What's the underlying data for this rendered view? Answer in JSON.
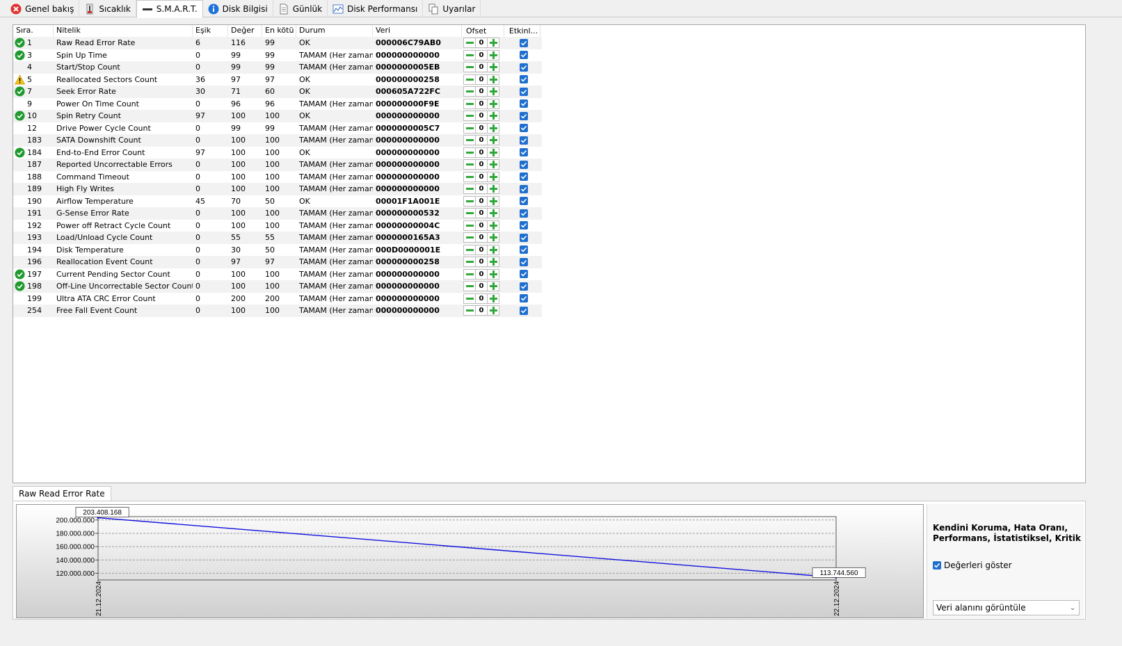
{
  "tabs": [
    {
      "label": "Genel bakış",
      "icon": "error-icon"
    },
    {
      "label": "Sıcaklık",
      "icon": "thermometer-icon"
    },
    {
      "label": "S.M.A.R.T.",
      "icon": "dash-icon"
    },
    {
      "label": "Disk Bilgisi",
      "icon": "info-icon"
    },
    {
      "label": "Günlük",
      "icon": "document-icon"
    },
    {
      "label": "Disk Performansı",
      "icon": "chart-icon"
    },
    {
      "label": "Uyarılar",
      "icon": "copy-icon"
    }
  ],
  "table": {
    "headers": {
      "id": "Sıra.",
      "name": "Nitelik",
      "threshold": "Eşik",
      "value": "Değer",
      "worst": "En kötü",
      "status": "Durum",
      "data": "Veri",
      "offset": "Ofset",
      "enabled": "Etkinl..."
    },
    "rows": [
      {
        "id": "1",
        "name": "Raw Read Error Rate",
        "threshold": "6",
        "value": "116",
        "worst": "99",
        "status": "OK",
        "data": "000006C79AB0",
        "offset": "0",
        "icon": "ok"
      },
      {
        "id": "3",
        "name": "Spin Up Time",
        "threshold": "0",
        "value": "99",
        "worst": "99",
        "status": "TAMAM (Her zaman ...",
        "data": "000000000000",
        "offset": "0",
        "icon": "ok"
      },
      {
        "id": "4",
        "name": "Start/Stop Count",
        "threshold": "0",
        "value": "99",
        "worst": "99",
        "status": "TAMAM (Her zaman ...",
        "data": "0000000005EB",
        "offset": "0",
        "icon": ""
      },
      {
        "id": "5",
        "name": "Reallocated Sectors Count",
        "threshold": "36",
        "value": "97",
        "worst": "97",
        "status": "OK",
        "data": "000000000258",
        "offset": "0",
        "icon": "warn"
      },
      {
        "id": "7",
        "name": "Seek Error Rate",
        "threshold": "30",
        "value": "71",
        "worst": "60",
        "status": "OK",
        "data": "000605A722FC",
        "offset": "0",
        "icon": "ok"
      },
      {
        "id": "9",
        "name": "Power On Time Count",
        "threshold": "0",
        "value": "96",
        "worst": "96",
        "status": "TAMAM (Her zaman ...",
        "data": "000000000F9E",
        "offset": "0",
        "icon": ""
      },
      {
        "id": "10",
        "name": "Spin Retry Count",
        "threshold": "97",
        "value": "100",
        "worst": "100",
        "status": "OK",
        "data": "000000000000",
        "offset": "0",
        "icon": "ok"
      },
      {
        "id": "12",
        "name": "Drive Power Cycle Count",
        "threshold": "0",
        "value": "99",
        "worst": "99",
        "status": "TAMAM (Her zaman ...",
        "data": "0000000005C7",
        "offset": "0",
        "icon": ""
      },
      {
        "id": "183",
        "name": "SATA Downshift Count",
        "threshold": "0",
        "value": "100",
        "worst": "100",
        "status": "TAMAM (Her zaman ...",
        "data": "000000000000",
        "offset": "0",
        "icon": ""
      },
      {
        "id": "184",
        "name": "End-to-End Error Count",
        "threshold": "97",
        "value": "100",
        "worst": "100",
        "status": "OK",
        "data": "000000000000",
        "offset": "0",
        "icon": "ok"
      },
      {
        "id": "187",
        "name": "Reported Uncorrectable Errors",
        "threshold": "0",
        "value": "100",
        "worst": "100",
        "status": "TAMAM (Her zaman ...",
        "data": "000000000000",
        "offset": "0",
        "icon": ""
      },
      {
        "id": "188",
        "name": "Command Timeout",
        "threshold": "0",
        "value": "100",
        "worst": "100",
        "status": "TAMAM (Her zaman ...",
        "data": "000000000000",
        "offset": "0",
        "icon": ""
      },
      {
        "id": "189",
        "name": "High Fly Writes",
        "threshold": "0",
        "value": "100",
        "worst": "100",
        "status": "TAMAM (Her zaman ...",
        "data": "000000000000",
        "offset": "0",
        "icon": ""
      },
      {
        "id": "190",
        "name": "Airflow Temperature",
        "threshold": "45",
        "value": "70",
        "worst": "50",
        "status": "OK",
        "data": "00001F1A001E",
        "offset": "0",
        "icon": ""
      },
      {
        "id": "191",
        "name": "G-Sense Error Rate",
        "threshold": "0",
        "value": "100",
        "worst": "100",
        "status": "TAMAM (Her zaman ...",
        "data": "000000000532",
        "offset": "0",
        "icon": ""
      },
      {
        "id": "192",
        "name": "Power off Retract Cycle Count",
        "threshold": "0",
        "value": "100",
        "worst": "100",
        "status": "TAMAM (Her zaman ...",
        "data": "00000000004C",
        "offset": "0",
        "icon": ""
      },
      {
        "id": "193",
        "name": "Load/Unload Cycle Count",
        "threshold": "0",
        "value": "55",
        "worst": "55",
        "status": "TAMAM (Her zaman ...",
        "data": "0000000165A3",
        "offset": "0",
        "icon": ""
      },
      {
        "id": "194",
        "name": "Disk Temperature",
        "threshold": "0",
        "value": "30",
        "worst": "50",
        "status": "TAMAM (Her zaman ...",
        "data": "000D0000001E",
        "offset": "0",
        "icon": ""
      },
      {
        "id": "196",
        "name": "Reallocation Event Count",
        "threshold": "0",
        "value": "97",
        "worst": "97",
        "status": "TAMAM (Her zaman ...",
        "data": "000000000258",
        "offset": "0",
        "icon": ""
      },
      {
        "id": "197",
        "name": "Current Pending Sector Count",
        "threshold": "0",
        "value": "100",
        "worst": "100",
        "status": "TAMAM (Her zaman ...",
        "data": "000000000000",
        "offset": "0",
        "icon": "ok"
      },
      {
        "id": "198",
        "name": "Off-Line Uncorrectable Sector Count",
        "threshold": "0",
        "value": "100",
        "worst": "100",
        "status": "TAMAM (Her zaman ...",
        "data": "000000000000",
        "offset": "0",
        "icon": "ok"
      },
      {
        "id": "199",
        "name": "Ultra ATA CRC Error Count",
        "threshold": "0",
        "value": "200",
        "worst": "200",
        "status": "TAMAM (Her zaman ...",
        "data": "000000000000",
        "offset": "0",
        "icon": ""
      },
      {
        "id": "254",
        "name": "Free Fall Event Count",
        "threshold": "0",
        "value": "100",
        "worst": "100",
        "status": "TAMAM (Her zaman ...",
        "data": "000000000000",
        "offset": "0",
        "icon": ""
      }
    ]
  },
  "bottom_tab": "Raw Read Error Rate",
  "side": {
    "title": "Kendini Koruma, Hata Oranı, Performans, İstatistiksel, Kritik",
    "show_values_label": "Değerleri göster",
    "show_values_checked": true,
    "select_value": "Veri alanını görüntüle"
  },
  "chart_data": {
    "type": "line",
    "x": [
      "21.12.2024",
      "22.12.2024"
    ],
    "series": [
      {
        "values": [
          203408168,
          113744560
        ]
      }
    ],
    "point_labels": [
      "203.408.168",
      "113.744.560"
    ],
    "yticks": [
      "200.000.000",
      "180.000.000",
      "160.000.000",
      "140.000.000",
      "120.000.000"
    ],
    "ytick_values": [
      200000000,
      180000000,
      160000000,
      140000000,
      120000000
    ],
    "ylim": [
      110000000,
      205000000
    ],
    "grid": true,
    "line_color": "#1010e0"
  }
}
